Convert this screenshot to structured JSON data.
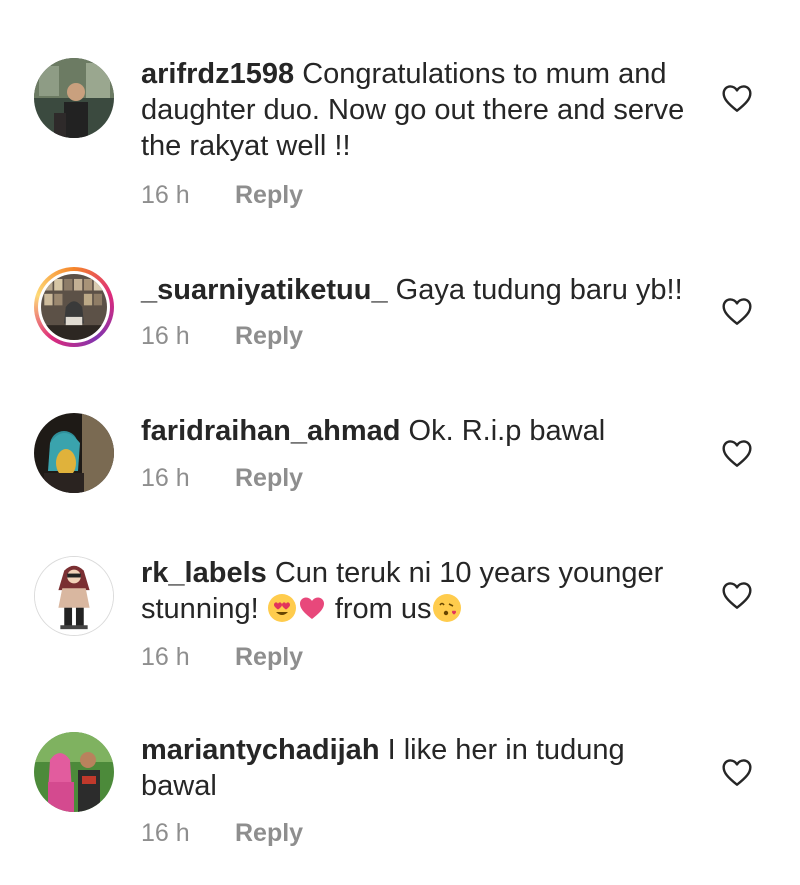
{
  "comments": [
    {
      "username": "arifrdz1598",
      "text": "Congratulations to mum and daughter duo. Now go out there and serve the rakyat well !!",
      "time": "16 h",
      "reply": "Reply",
      "avatar_icon": "profile-photo"
    },
    {
      "username": "_suarniyatiketuu_",
      "text": "Gaya tudung baru yb!!",
      "time": "16 h",
      "reply": "Reply",
      "avatar_icon": "profile-photo-story-ring"
    },
    {
      "username": "faridraihan_ahmad",
      "text": "Ok. R.i.p bawal",
      "time": "16 h",
      "reply": "Reply",
      "avatar_icon": "profile-photo"
    },
    {
      "username": "rk_labels",
      "text_line1": "Cun teruk ni 10 years younger stunning!",
      "text_line2": "from us",
      "emojis": [
        "heart-eyes-emoji",
        "pink-heart-emoji",
        "kissing-heart-emoji"
      ],
      "time": "16 h",
      "reply": "Reply",
      "avatar_icon": "illustrated-hijab-avatar"
    },
    {
      "username": "mariantychadijah",
      "text": "I like her  in tudung bawal",
      "time": "16 h",
      "reply": "Reply",
      "avatar_icon": "profile-photo"
    }
  ],
  "colors": {
    "text": "#262626",
    "meta": "#8e8e8e",
    "story_ring": "#dd2a7b"
  },
  "icons": {
    "like": "heart-outline-icon"
  }
}
